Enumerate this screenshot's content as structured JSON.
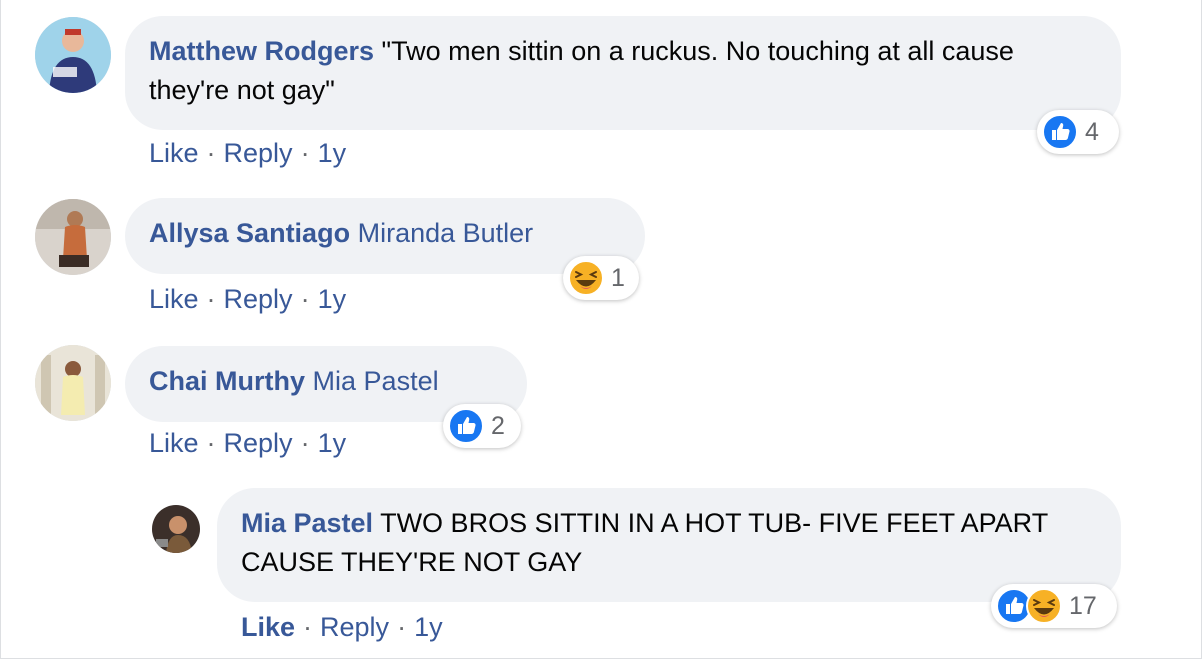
{
  "comments": [
    {
      "author": "Matthew Rodgers",
      "text": "\"Two men sittin on a ruckus. No touching at all cause they're not gay\"",
      "actions": {
        "like": "Like",
        "reply": "Reply",
        "time": "1y"
      },
      "reaction_count": "4",
      "reactions": [
        "like-icon"
      ]
    },
    {
      "author": "Allysa Santiago",
      "mention": "Miranda Butler",
      "actions": {
        "like": "Like",
        "reply": "Reply",
        "time": "1y"
      },
      "reaction_count": "1",
      "reactions": [
        "haha-icon"
      ]
    },
    {
      "author": "Chai Murthy",
      "mention": "Mia Pastel",
      "actions": {
        "like": "Like",
        "reply": "Reply",
        "time": "1y"
      },
      "reaction_count": "2",
      "reactions": [
        "like-icon"
      ]
    },
    {
      "author": "Mia Pastel",
      "text": "TWO BROS SITTIN IN A HOT TUB- FIVE FEET APART CAUSE THEY'RE NOT GAY",
      "actions": {
        "like": "Like",
        "reply": "Reply",
        "time": "1y"
      },
      "reaction_count": "17",
      "reactions": [
        "like-icon",
        "haha-icon"
      ],
      "liked_by_viewer": true
    }
  ],
  "separator": "·",
  "colors": {
    "name": "#385898",
    "bubble": "#f0f2f5",
    "like_blue": "#1877f2",
    "haha_yellow": "#f7b125"
  }
}
